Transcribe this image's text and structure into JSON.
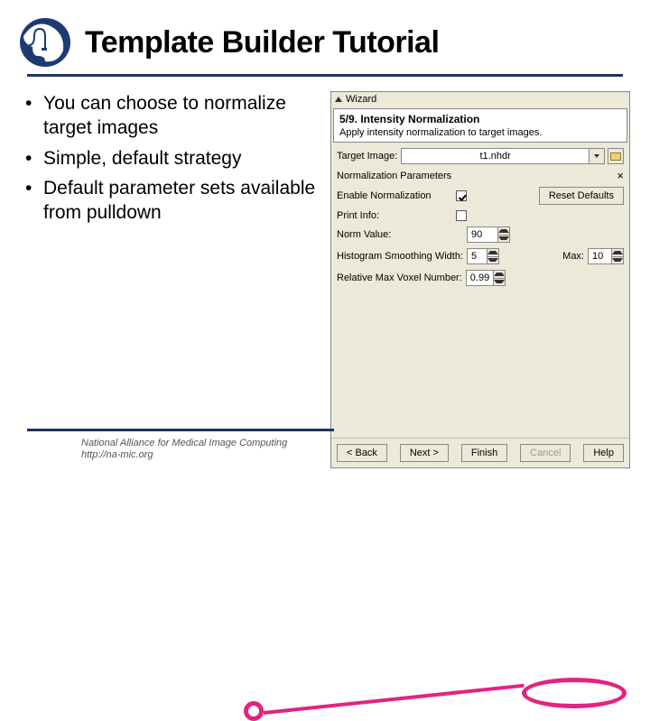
{
  "header": {
    "title": "Template Builder Tutorial"
  },
  "bullets": [
    "You can choose to normalize target images",
    "Simple, default strategy",
    "Default parameter sets available from pulldown"
  ],
  "wizard": {
    "window_title": "Wizard",
    "step_title": "5/9. Intensity Normalization",
    "step_desc": "Apply intensity normalization to target images.",
    "target_image_label": "Target Image:",
    "target_image_value": "t1.nhdr",
    "section_title": "Normalization Parameters",
    "enable_label": "Enable Normalization",
    "reset_defaults": "Reset Defaults",
    "print_info_label": "Print Info:",
    "norm_value_label": "Norm Value:",
    "norm_value": "90",
    "hist_smooth_label": "Histogram Smoothing Width:",
    "hist_smooth_value": "5",
    "max_label": "Max:",
    "max_value": "10",
    "rel_max_label": "Relative Max Voxel Number:",
    "rel_max_value": "0.99",
    "buttons": {
      "back": "< Back",
      "next": "Next >",
      "finish": "Finish",
      "cancel": "Cancel",
      "help": "Help"
    }
  },
  "footer": {
    "line1": "National Alliance for Medical Image Computing",
    "line2": "http://na-mic.org"
  }
}
